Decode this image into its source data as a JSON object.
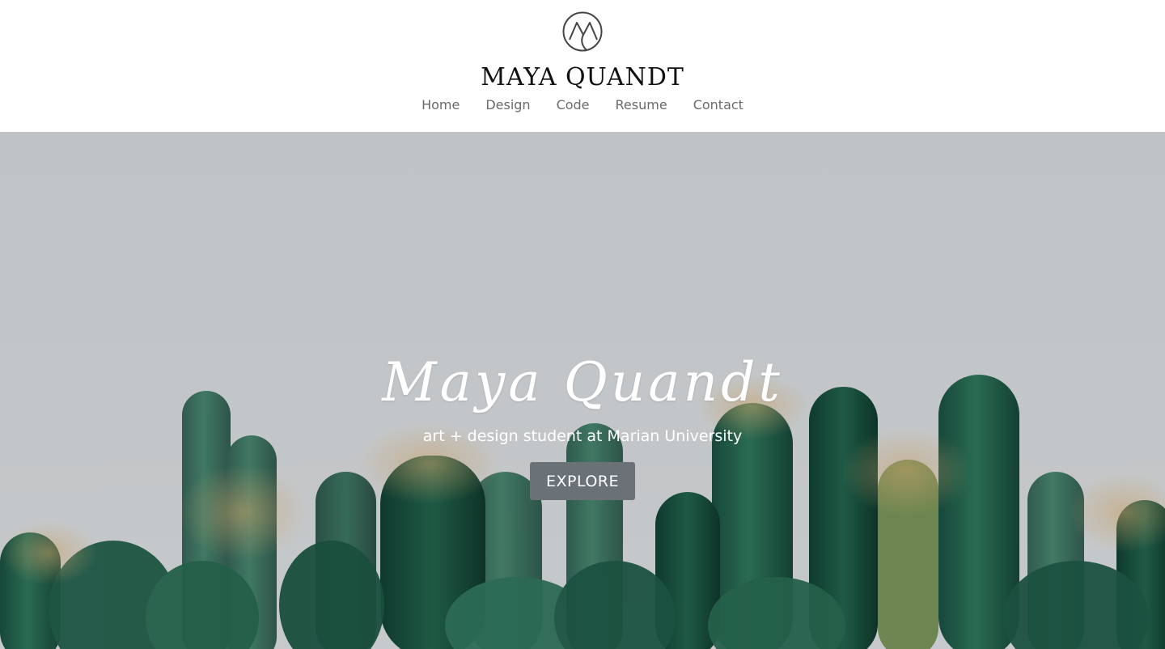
{
  "header": {
    "logo_icon": "mq-monogram-icon",
    "site_title": "MAYA QUANDT",
    "nav": [
      {
        "label": "Home"
      },
      {
        "label": "Design"
      },
      {
        "label": "Code"
      },
      {
        "label": "Resume"
      },
      {
        "label": "Contact"
      }
    ]
  },
  "hero": {
    "title": "Maya Quandt",
    "subtitle": "art + design student at Marian University",
    "cta_label": "EXPLORE",
    "background": "cactus-photo"
  },
  "colors": {
    "header_bg": "#ffffff",
    "title_text": "#111111",
    "nav_text": "#6a6a6a",
    "hero_sky": "#c1c5c7",
    "cactus_green": "#1f5a45",
    "button_bg": "#6a7278",
    "hero_text": "#ffffff"
  }
}
